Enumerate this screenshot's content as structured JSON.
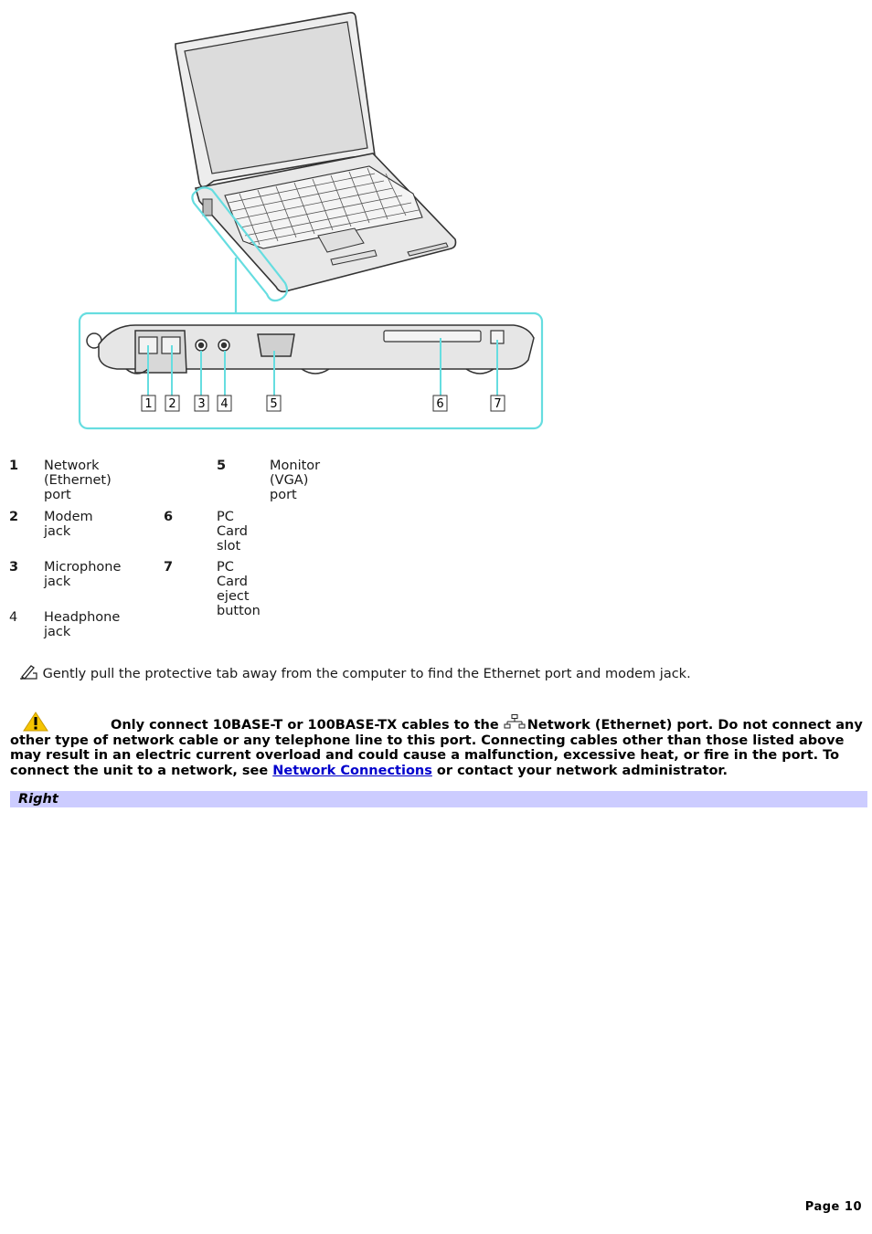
{
  "figure": {
    "description": "Laptop with callout of left side ports",
    "callout_numbers": [
      "1",
      "2",
      "3",
      "4",
      "5",
      "6",
      "7"
    ],
    "accent_color": "#66dde0"
  },
  "legend": {
    "items": [
      {
        "num": "1",
        "label": "Network (Ethernet) port"
      },
      {
        "num": "2",
        "label": "Modem jack"
      },
      {
        "num": "3",
        "label": "Microphone jack"
      },
      {
        "num": "4",
        "label": "Headphone jack"
      },
      {
        "num": "5",
        "label": "Monitor (VGA) port"
      },
      {
        "num": "6",
        "label": "PC Card slot"
      },
      {
        "num": "7",
        "label": "PC Card eject button"
      }
    ]
  },
  "note": {
    "icon": "note-pencil-icon",
    "text": "Gently pull the protective tab away from the computer to find the Ethernet port and modem jack."
  },
  "warning": {
    "icon": "warning-triangle-icon",
    "text_before": "Only connect 10BASE-T or 100BASE-TX cables to the ",
    "inline_icon": "network-port-icon",
    "text_middle": "Network (Ethernet) port. Do not connect any other type of network cable or any telephone line to this port. Connecting cables other than those listed above may result in an electric current overload and could cause a malfunction, excessive heat, or fire in the port. To connect the unit to a network, see ",
    "link_text": "Network Connections",
    "text_after": " or contact your network administrator."
  },
  "section": {
    "title": "Right",
    "bg_color": "#ccccff"
  },
  "footer": {
    "page_label": "Page 10"
  }
}
